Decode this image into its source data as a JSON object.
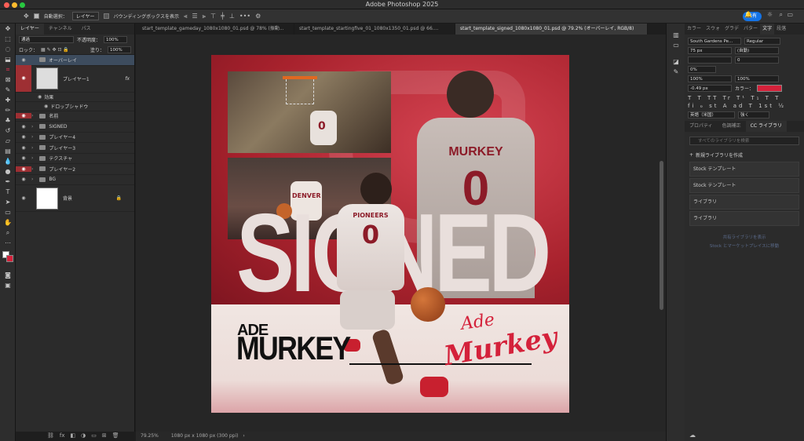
{
  "app": {
    "title": "Adobe Photoshop 2025",
    "share_label": "共有"
  },
  "options_bar": {
    "auto_select_label": "自動選択：",
    "auto_select_target": "レイヤー",
    "bounding_box_label": "バウンディングボックスを表示"
  },
  "tabs": [
    {
      "label": "start_template_gameday_1080x1080_01.psd @ 78% (振動..."
    },
    {
      "label": "start_template_startingfive_01_1080x1350_01.psd @ 66...."
    },
    {
      "label": "start_template_signed_1080x1080_01.psd @ 79.2% (オーバーレイ, RGB/8)"
    }
  ],
  "layers_panel": {
    "tabs": [
      "レイヤー",
      "チャンネル",
      "パス"
    ],
    "blend_mode": "通過",
    "opacity_label": "不透明度：",
    "opacity_value": "100%",
    "lock_label": "ロック：",
    "fill_label": "塗り：",
    "fill_value": "100%",
    "layers": [
      {
        "name": "オーバーレイ"
      },
      {
        "name": "プレイヤー1"
      },
      {
        "name": "効果"
      },
      {
        "name": "ドロップシャドウ"
      },
      {
        "name": "名前"
      },
      {
        "name": "SIGNED"
      },
      {
        "name": "プレイヤー4"
      },
      {
        "name": "プレイヤー3"
      },
      {
        "name": "テクスチャ"
      },
      {
        "name": "プレイヤー2"
      },
      {
        "name": "BG"
      },
      {
        "name": "背景"
      }
    ],
    "fx_label": "fx"
  },
  "canvas": {
    "headline": "SIGNED",
    "first_name": "ADE",
    "last_name": "MURKEY",
    "signature_line1": "Ade",
    "signature_line2": "Murkey",
    "jersey_team_front": "PIONEERS",
    "jersey_team_small": "DENVER",
    "jersey_back_name": "MURKEY",
    "jersey_number": "0"
  },
  "status": {
    "zoom": "79.25%",
    "doc_info": "1080 px x 1080 px (300 ppi)"
  },
  "right_panel": {
    "tabs": [
      "カラー",
      "スウォ",
      "グラデ",
      "パター",
      "文字",
      "段落"
    ],
    "font_family": "South Gardens Pe...",
    "font_style": "Regular",
    "font_size": "75 px",
    "leading": "(自動)",
    "tracking": "0",
    "kerning_pct": "0%",
    "vscale": "100%",
    "hscale": "100%",
    "baseline": "-0.49 px",
    "color_label": "カラー：",
    "text_color": "#d4213a",
    "language": "英語（米国）",
    "aa": "強く",
    "lib_tabs": [
      "プロパティ",
      "色調補正",
      "CC ライブラリ"
    ],
    "lib_search_placeholder": "すべてのライブラリを検索",
    "new_library": "新規ライブラリを作成",
    "library_items": [
      "Stock テンプレート",
      "Stock テンプレート",
      "ライブラリ",
      "ライブラリ"
    ],
    "footer_link1": "共有ライブラリを表示",
    "footer_link2": "Stock とマーケットプレイスに移動"
  }
}
